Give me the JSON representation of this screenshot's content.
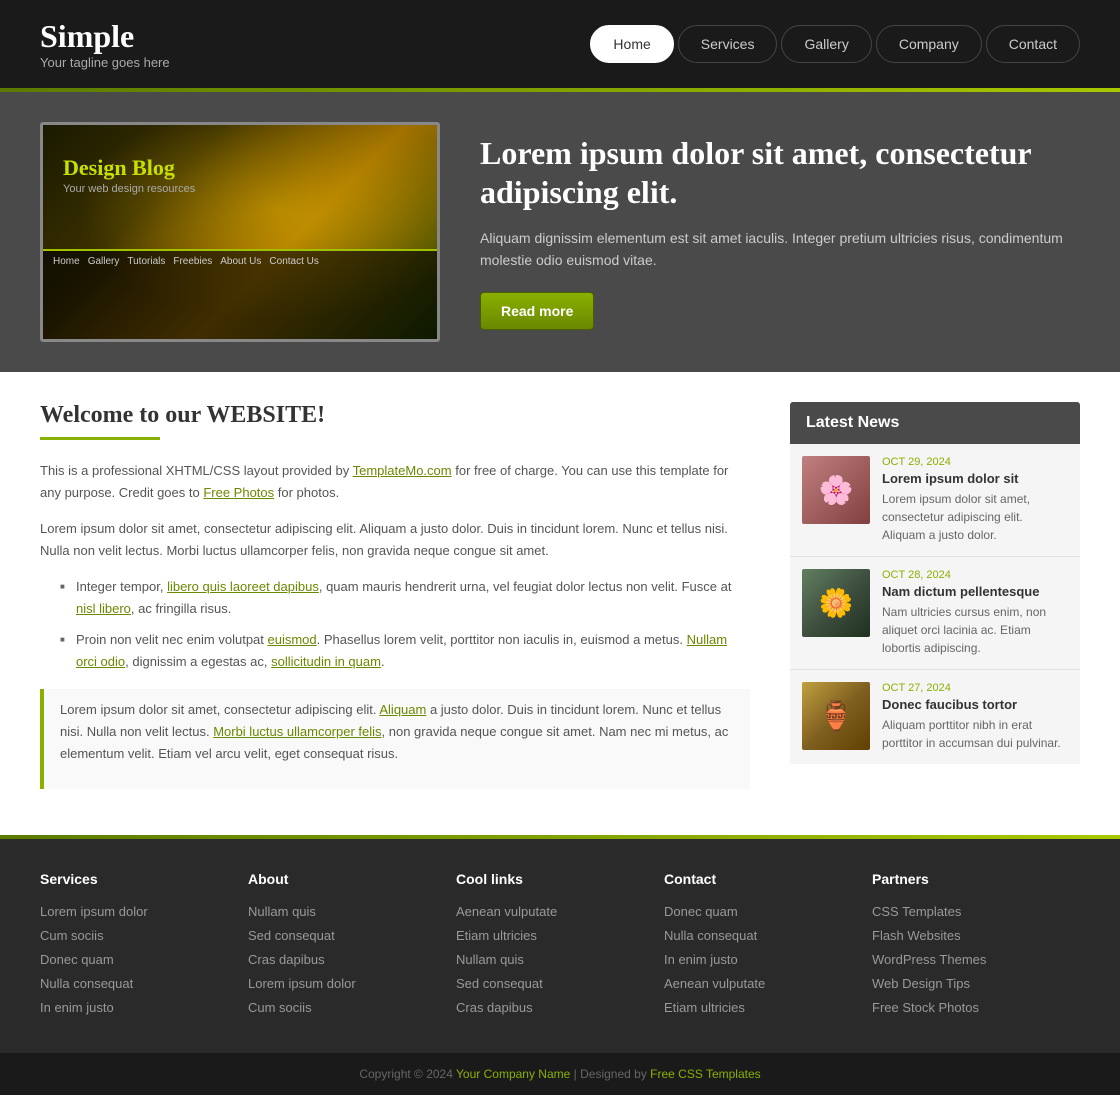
{
  "site": {
    "title": "Simple",
    "tagline": "Your tagline goes here"
  },
  "nav": {
    "items": [
      {
        "label": "Home",
        "active": true
      },
      {
        "label": "Services",
        "active": false
      },
      {
        "label": "Gallery",
        "active": false
      },
      {
        "label": "Company",
        "active": false
      },
      {
        "label": "Contact",
        "active": false
      }
    ]
  },
  "hero": {
    "image_title": "Design Blog",
    "image_subtitle": "Your web design resources",
    "heading": "Lorem ipsum dolor sit amet, consectetur adipiscing elit.",
    "body": "Aliquam dignissim elementum est sit amet iaculis. Integer pretium ultricies risus, condimentum molestie odio euismod vitae.",
    "button_label": "Read more"
  },
  "content": {
    "heading": "Welcome to our WEBSITE!",
    "intro_text": "This is a professional XHTML/CSS layout provided by TemplateMo.com for free of charge. You can use this template for any purpose. Credit goes to Free Photos for photos.",
    "body1": "Lorem ipsum dolor sit amet, consectetur adipiscing elit. Aliquam a justo dolor. Duis in tincidunt lorem. Nunc et tellus nisi. Nulla non velit lectus. Morbi luctus ullamcorper felis, non gravida neque congue sit amet.",
    "list_item1": "Integer tempor, libero quis laoreet dapibus, quam mauris hendrerit urna, vel feugiat dolor lectus non velit. Fusce at nisl libero, ac fringilla risus.",
    "list_item2": "Proin non velit nec enim volutpat euismod. Phasellus lorem velit, porttitor non iaculis in, euismod a metus. Nullam orci odio, dignissim a egestas ac, sollicitudin in quam.",
    "blockquote": "Lorem ipsum dolor sit amet, consectetur adipiscing elit. Aliquam a justo dolor. Duis in tincidunt lorem. Nunc et tellus nisi. Nulla non velit lectus. Morbi luctus ullamcorper felis, non gravida neque congue sit amet. Nam nec mi metus, ac elementum velit. Etiam vel arcu velit, eget consequat risus."
  },
  "sidebar": {
    "news_heading": "Latest News",
    "news_items": [
      {
        "date": "OCT 29, 2024",
        "title": "Lorem ipsum dolor sit",
        "excerpt": "Lorem ipsum dolor sit amet, consectetur adipiscing elit. Aliquam a justo dolor.",
        "thumb_class": "news-thumb-1"
      },
      {
        "date": "OCT 28, 2024",
        "title": "Nam dictum pellentesque",
        "excerpt": "Nam ultricies cursus enim, non aliquet orci lacinia ac. Etiam lobortis adipiscing.",
        "thumb_class": "news-thumb-2"
      },
      {
        "date": "OCT 27, 2024",
        "title": "Donec faucibus tortor",
        "excerpt": "Aliquam porttitor nibh in erat porttitor in accumsan dui pulvinar.",
        "thumb_class": "news-thumb-3"
      }
    ]
  },
  "footer": {
    "columns": [
      {
        "heading": "Services",
        "links": [
          "Lorem ipsum dolor",
          "Cum sociis",
          "Donec quam",
          "Nulla consequat",
          "In enim justo"
        ]
      },
      {
        "heading": "About",
        "links": [
          "Nullam quis",
          "Sed consequat",
          "Cras dapibus",
          "Lorem ipsum dolor",
          "Cum sociis"
        ]
      },
      {
        "heading": "Cool links",
        "links": [
          "Aenean vulputate",
          "Etiam ultricies",
          "Nullam quis",
          "Sed consequat",
          "Cras dapibus"
        ]
      },
      {
        "heading": "Contact",
        "links": [
          "Donec quam",
          "Nulla consequat",
          "In enim justo",
          "Aenean vulputate",
          "Etiam ultricies"
        ]
      },
      {
        "heading": "Partners",
        "links": [
          "CSS Templates",
          "Flash Websites",
          "WordPress Themes",
          "Web Design Tips",
          "Free Stock Photos"
        ]
      }
    ],
    "copyright": "Copyright © 2024",
    "company_name": "Your Company Name",
    "designed_by": "Designed by",
    "designer": "Free CSS Templates"
  }
}
